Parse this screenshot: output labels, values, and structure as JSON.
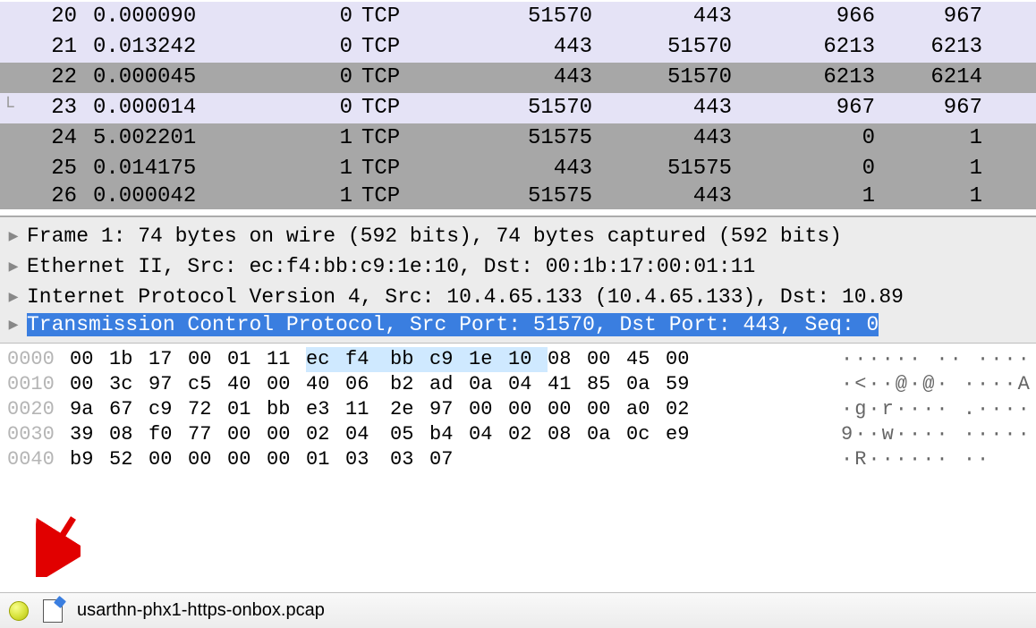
{
  "packets": [
    {
      "num": "20",
      "time": "0.000090",
      "len": "0",
      "proto": "TCP",
      "sport": "51570",
      "dport": "443",
      "seq": "966",
      "ack": "967",
      "bg": "lav",
      "tree": ""
    },
    {
      "num": "21",
      "time": "0.013242",
      "len": "0",
      "proto": "TCP",
      "sport": "443",
      "dport": "51570",
      "seq": "6213",
      "ack": "6213",
      "bg": "lav",
      "tree": ""
    },
    {
      "num": "22",
      "time": "0.000045",
      "len": "0",
      "proto": "TCP",
      "sport": "443",
      "dport": "51570",
      "seq": "6213",
      "ack": "6214",
      "bg": "gray",
      "tree": ""
    },
    {
      "num": "23",
      "time": "0.000014",
      "len": "0",
      "proto": "TCP",
      "sport": "51570",
      "dport": "443",
      "seq": "967",
      "ack": "967",
      "bg": "lav",
      "tree": "└"
    },
    {
      "num": "24",
      "time": "5.002201",
      "len": "1",
      "proto": "TCP",
      "sport": "51575",
      "dport": "443",
      "seq": "0",
      "ack": "1",
      "bg": "gray",
      "tree": ""
    },
    {
      "num": "25",
      "time": "0.014175",
      "len": "1",
      "proto": "TCP",
      "sport": "443",
      "dport": "51575",
      "seq": "0",
      "ack": "1",
      "bg": "gray",
      "tree": ""
    },
    {
      "num": "26",
      "time": "0.000042",
      "len": "1",
      "proto": "TCP",
      "sport": "51575",
      "dport": "443",
      "seq": "1",
      "ack": "1",
      "bg": "cut",
      "tree": ""
    }
  ],
  "details": [
    {
      "text": "Frame 1: 74 bytes on wire (592 bits), 74 bytes captured (592 bits)",
      "cut": false
    },
    {
      "text": "Ethernet II, Src: ec:f4:bb:c9:1e:10, Dst: 00:1b:17:00:01:11",
      "cut": false
    },
    {
      "text": "Internet Protocol Version 4, Src: 10.4.65.133 (10.4.65.133), Dst: 10.89",
      "cut": false
    },
    {
      "text": "Transmission Control Protocol, Src Port: 51570, Dst Port: 443, Seq: 0",
      "cut": true
    }
  ],
  "hex": {
    "rows": [
      {
        "offset": "0000",
        "bytes": [
          "00",
          "1b",
          "17",
          "00",
          "01",
          "11",
          "ec",
          "f4",
          "bb",
          "c9",
          "1e",
          "10",
          "08",
          "00",
          "45",
          "00"
        ],
        "hl_start": 6,
        "hl_end": 12,
        "ascii": "······ ·· ····"
      },
      {
        "offset": "0010",
        "bytes": [
          "00",
          "3c",
          "97",
          "c5",
          "40",
          "00",
          "40",
          "06",
          "b2",
          "ad",
          "0a",
          "04",
          "41",
          "85",
          "0a",
          "59"
        ],
        "hl_start": -1,
        "hl_end": -1,
        "ascii": "·<··@·@· ····A"
      },
      {
        "offset": "0020",
        "bytes": [
          "9a",
          "67",
          "c9",
          "72",
          "01",
          "bb",
          "e3",
          "11",
          "2e",
          "97",
          "00",
          "00",
          "00",
          "00",
          "a0",
          "02"
        ],
        "hl_start": -1,
        "hl_end": -1,
        "ascii": "·g·r···· .····"
      },
      {
        "offset": "0030",
        "bytes": [
          "39",
          "08",
          "f0",
          "77",
          "00",
          "00",
          "02",
          "04",
          "05",
          "b4",
          "04",
          "02",
          "08",
          "0a",
          "0c",
          "e9"
        ],
        "hl_start": -1,
        "hl_end": -1,
        "ascii": "9··w···· ·····"
      },
      {
        "offset": "0040",
        "bytes": [
          "b9",
          "52",
          "00",
          "00",
          "00",
          "00",
          "01",
          "03",
          "03",
          "07",
          "",
          "",
          "",
          "",
          "",
          ""
        ],
        "hl_start": -1,
        "hl_end": -1,
        "ascii": "·R······ ··"
      }
    ]
  },
  "status": {
    "filename": "usarthn-phx1-https-onbox.pcap"
  }
}
